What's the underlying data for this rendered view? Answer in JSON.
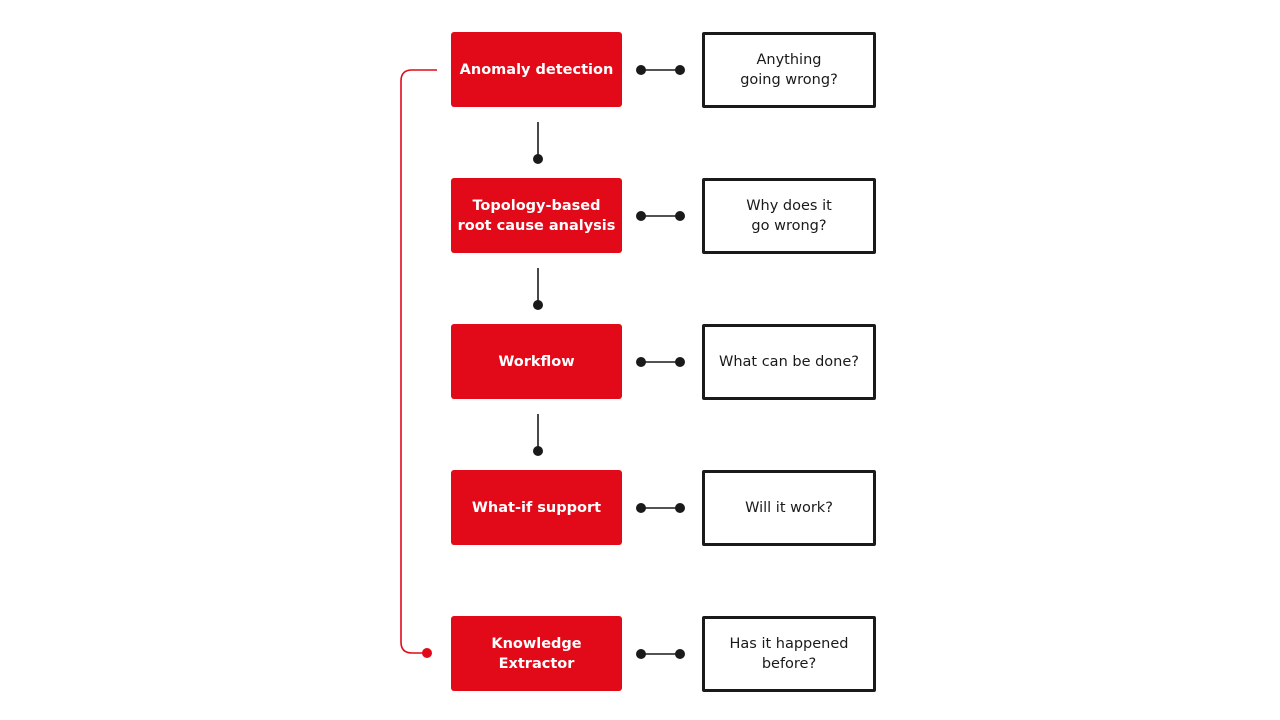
{
  "colors": {
    "accent": "#e20a19",
    "ink": "#1a1a1a"
  },
  "steps": [
    {
      "label": "Anomaly detection",
      "question": "Anything\ngoing wrong?"
    },
    {
      "label": "Topology-based\nroot cause analysis",
      "question": "Why does it\ngo wrong?"
    },
    {
      "label": "Workflow",
      "question": "What can be done?"
    },
    {
      "label": "What-if support",
      "question": "Will it work?"
    },
    {
      "label": "Knowledge\nExtractor",
      "question": "Has it happened\nbefore?"
    }
  ]
}
